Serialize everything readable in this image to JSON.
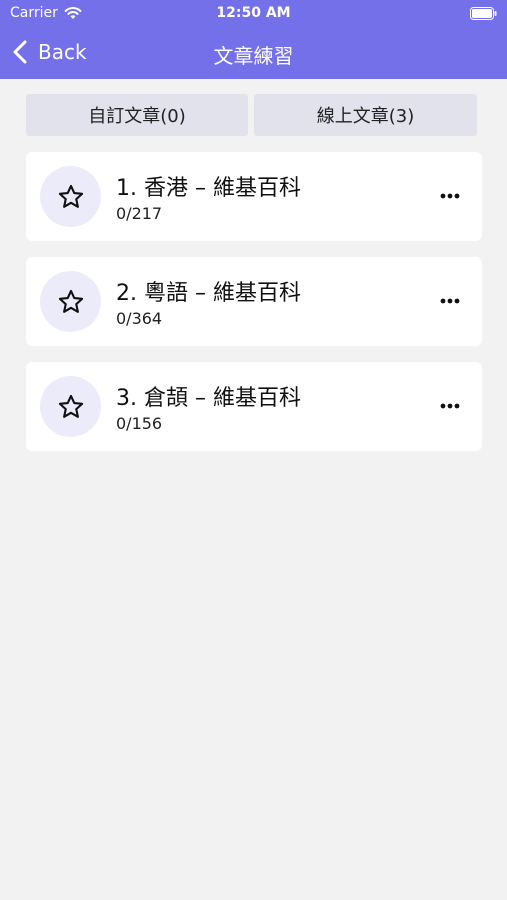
{
  "status_bar": {
    "carrier": "Carrier",
    "time": "12:50 AM"
  },
  "nav": {
    "back_label": "Back",
    "title": "文章練習"
  },
  "segments": {
    "custom": "自訂文章(0)",
    "online": "線上文章(3)"
  },
  "articles": [
    {
      "title": "1. 香港 – 維基百科",
      "progress": "0/217"
    },
    {
      "title": "2. 粵語 – 維基百科",
      "progress": "0/364"
    },
    {
      "title": "3. 倉頡 – 維基百科",
      "progress": "0/156"
    }
  ],
  "colors": {
    "header": "#7470ea",
    "segment_bg": "#e2e2ec",
    "star_circle": "#ebebfa",
    "page_bg": "#f2f2f2"
  },
  "icons": {
    "back": "chevron-left-icon",
    "star": "star-outline-icon",
    "more": "ellipsis-icon",
    "wifi": "wifi-icon",
    "battery": "battery-icon"
  }
}
